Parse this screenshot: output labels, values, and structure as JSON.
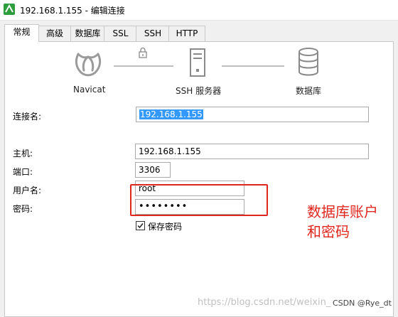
{
  "window": {
    "title": "192.168.1.155 - 编辑连接",
    "icon": "navicat-icon"
  },
  "tabs": [
    {
      "label": "常规",
      "active": true
    },
    {
      "label": "高级"
    },
    {
      "label": "数据库"
    },
    {
      "label": "SSL"
    },
    {
      "label": "SSH"
    },
    {
      "label": "HTTP"
    }
  ],
  "diagram": {
    "client_label": "Navicat",
    "ssh_label": "SSH 服务器",
    "db_label": "数据库",
    "icons": [
      "navicat-logo-icon",
      "lock-icon",
      "server-icon",
      "database-icon"
    ]
  },
  "form": {
    "connection_name": {
      "label": "连接名:",
      "value": "192.168.1.155"
    },
    "host": {
      "label": "主机:",
      "value": "192.168.1.155"
    },
    "port": {
      "label": "端口:",
      "value": "3306"
    },
    "username": {
      "label": "用户名:",
      "value": "root"
    },
    "password": {
      "label": "密码:",
      "value": "••••••••"
    },
    "save_password": {
      "label": "保存密码",
      "checked": true
    }
  },
  "annotation": {
    "line1": "数据库账户",
    "line2": "和密码",
    "color": "#e0271e"
  },
  "watermark": "https://blog.csdn.net/weixin_",
  "credit": "CSDN @Rye_dt"
}
